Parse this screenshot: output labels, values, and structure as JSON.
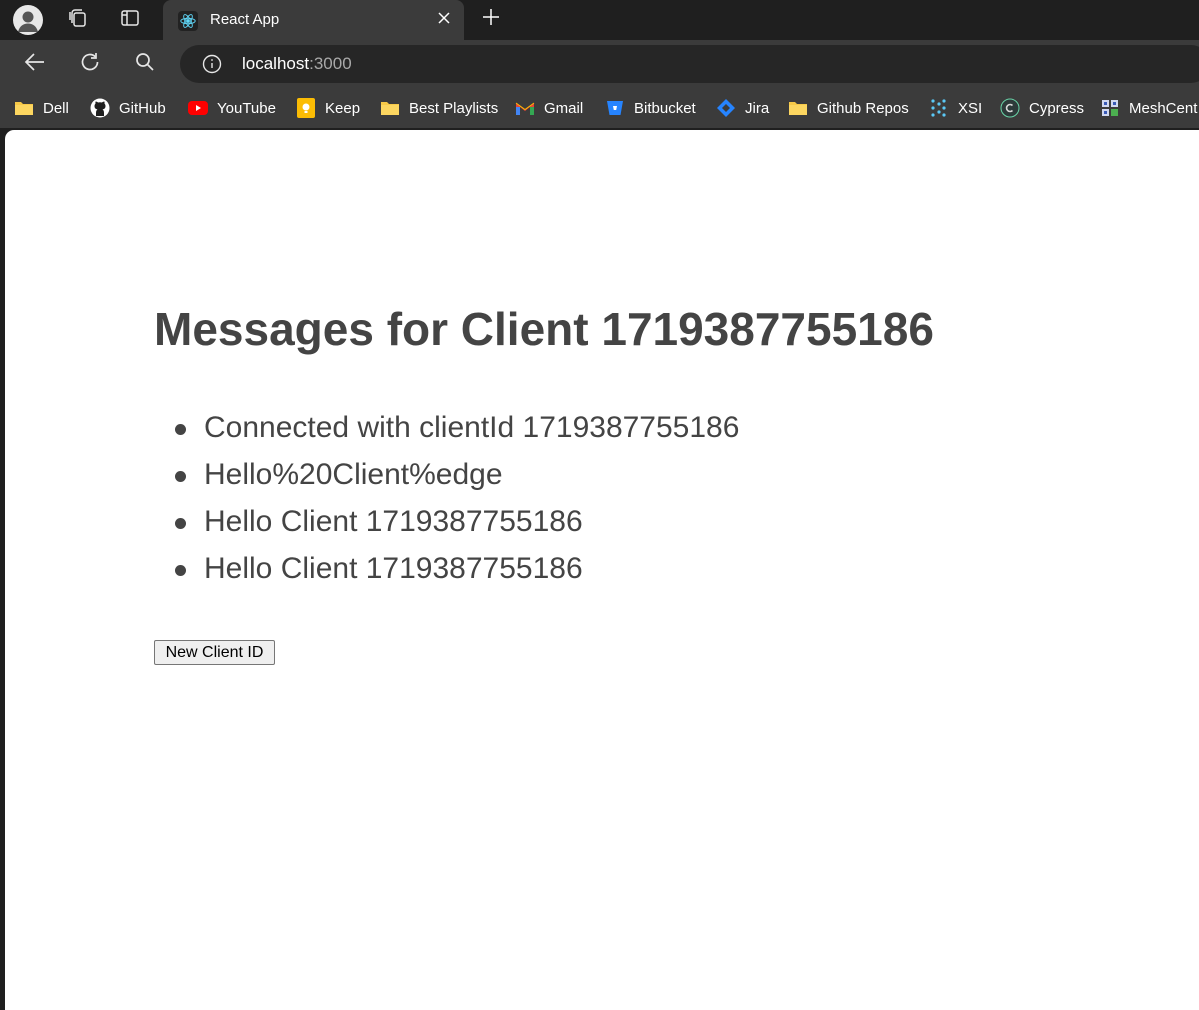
{
  "browser": {
    "tab": {
      "title": "React App"
    },
    "address": {
      "host": "localhost",
      "port": ":3000"
    },
    "bookmarks": [
      {
        "label": "Dell",
        "icon": "folder-icon"
      },
      {
        "label": "GitHub",
        "icon": "github-icon"
      },
      {
        "label": "YouTube",
        "icon": "youtube-icon"
      },
      {
        "label": "Keep",
        "icon": "keep-icon"
      },
      {
        "label": "Best Playlists",
        "icon": "folder-icon"
      },
      {
        "label": "Gmail",
        "icon": "gmail-icon"
      },
      {
        "label": "Bitbucket",
        "icon": "bitbucket-icon"
      },
      {
        "label": "Jira",
        "icon": "jira-icon"
      },
      {
        "label": "Github Repos",
        "icon": "folder-icon"
      },
      {
        "label": "XSI",
        "icon": "xsi-icon"
      },
      {
        "label": "Cypress",
        "icon": "cypress-icon"
      },
      {
        "label": "MeshCent",
        "icon": "meshcentral-icon"
      }
    ]
  },
  "page": {
    "heading": "Messages for Client 1719387755186",
    "messages": [
      "Connected with clientId 1719387755186",
      "Hello%20Client%edge",
      "Hello Client 1719387755186",
      "Hello Client 1719387755186"
    ],
    "button_label": "New Client ID"
  },
  "colors": {
    "chrome_dark": "#1f1f1f",
    "toolbar": "#3b3b3b",
    "text_main": "#444444"
  }
}
